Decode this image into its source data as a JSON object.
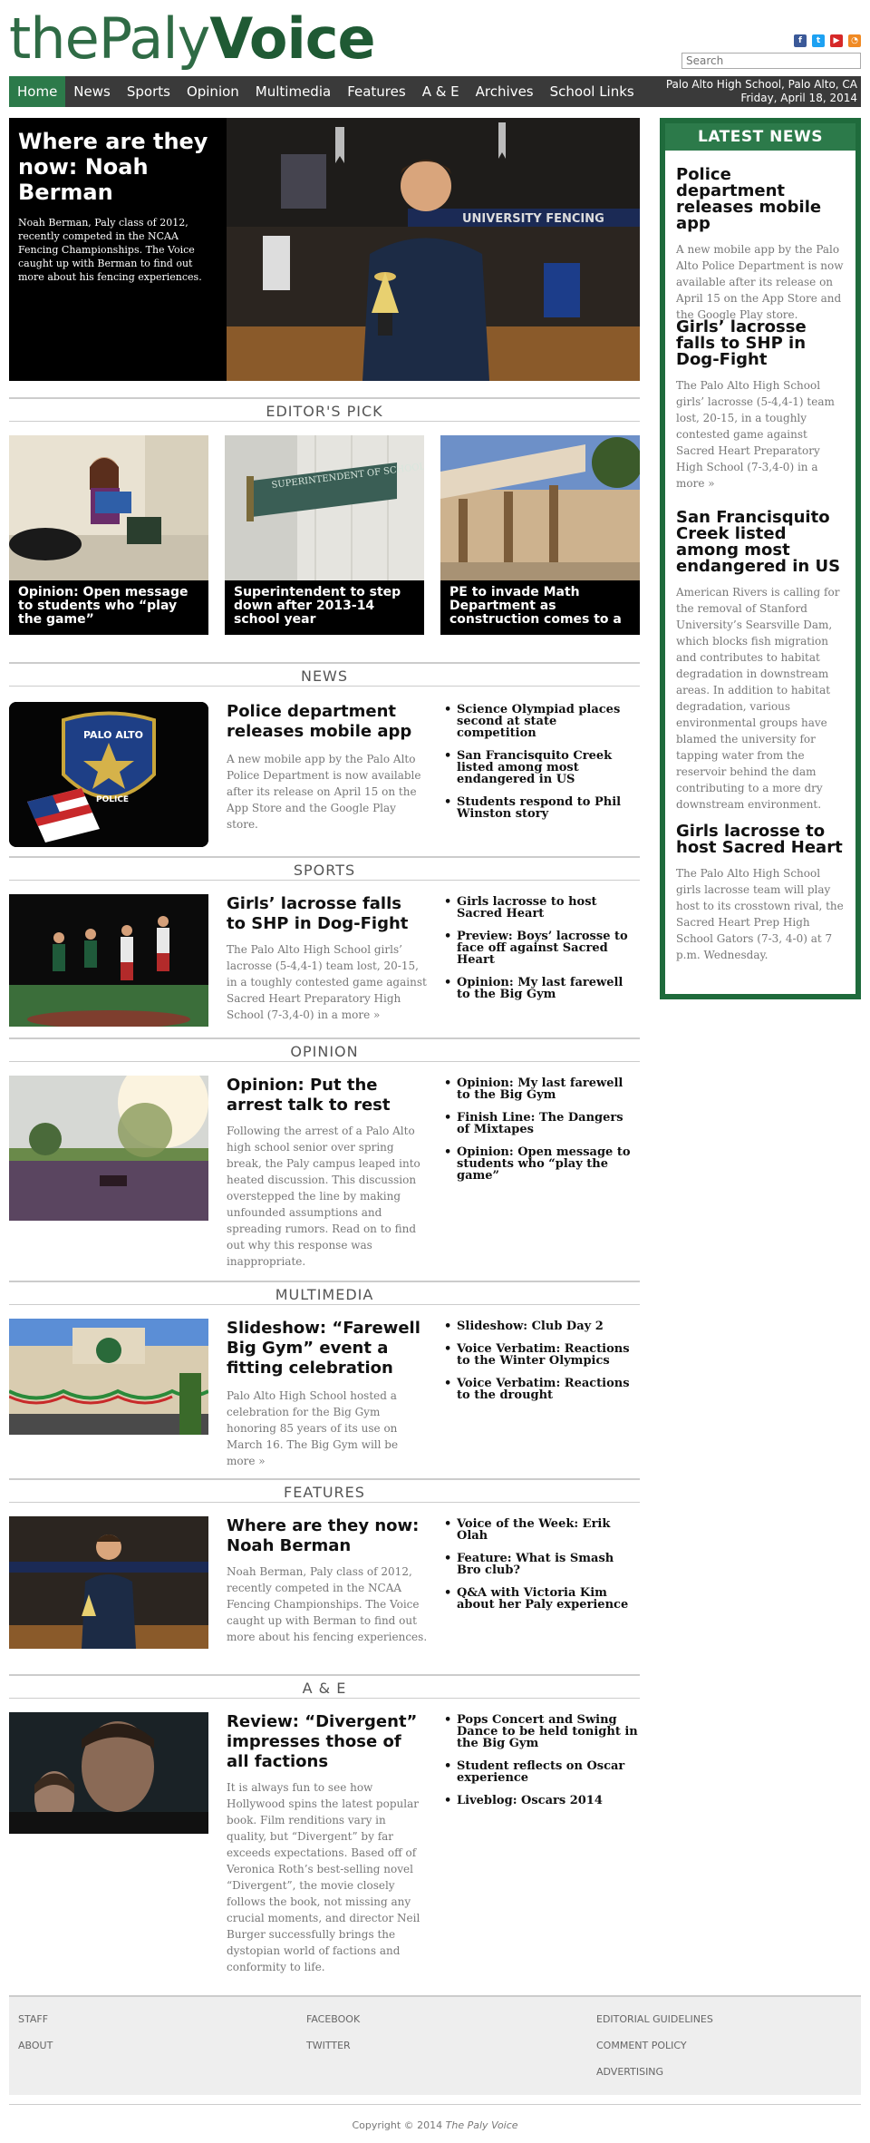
{
  "header": {
    "logo_part1": "the",
    "logo_part2": "Paly",
    "logo_part3": "Voice",
    "search_placeholder": "Search",
    "social": [
      "facebook-icon",
      "twitter-icon",
      "youtube-icon",
      "rss-icon"
    ]
  },
  "nav": {
    "items": [
      "Home",
      "News",
      "Sports",
      "Opinion",
      "Multimedia",
      "Features",
      "A & E",
      "Archives",
      "School Links"
    ],
    "active": "Home",
    "location": "Palo Alto High School, Palo Alto, CA",
    "date": "Friday, April 18, 2014"
  },
  "hero": {
    "title": "Where are they now: Noah Berman",
    "text": "Noah Berman, Paly class of 2012, recently competed in the NCAA Fencing Championships. The Voice caught up with Berman to find out more about his fencing experiences."
  },
  "sidebar": {
    "title": "LATEST NEWS",
    "items": [
      {
        "title": "Police department releases mobile app",
        "text": "A new mobile app by the Palo Alto Police Department is now available after its release on April 15 on the App Store and the Google Play store."
      },
      {
        "title": "Girls’ lacrosse falls to SHP in Dog-Fight",
        "text": "The Palo Alto High School girls’ lacrosse (5-4,4-1) team lost, 20-15, in a toughly contested game against Sacred Heart Preparatory High School (7-3,4-0) in a more »"
      },
      {
        "title": "San Francisquito Creek listed among most endangered in US",
        "text": "American Rivers is calling for the removal of Stanford University’s Searsville Dam, which blocks fish migration and contributes to habitat degradation in downstream areas. In addition to habitat degradation, various environmental groups have blamed the university for tapping water from the reservoir behind the dam contributing to a more dry downstream environment."
      },
      {
        "title": "Girls lacrosse to host Sacred Heart",
        "text": "The Palo Alto High School girls lacrosse team will play host to its crosstown rival, the Sacred Heart Prep High School Gators (7-3, 4-0) at 7 p.m. Wednesday."
      }
    ]
  },
  "editors_pick": {
    "heading": "EDITOR'S PICK",
    "items": [
      {
        "caption": "Opinion: Open message to students who “play the game”"
      },
      {
        "caption": "Superintendent to step down after 2013-14 school year",
        "sign": "SUPERINTENDENT OF SCHOOLS"
      },
      {
        "caption": "PE to invade Math Department as construction comes to a"
      }
    ]
  },
  "news": {
    "heading": "NEWS",
    "title": "Police department releases mobile app",
    "text": "A new mobile app by the Palo Alto Police Department is now available after its release on April 15 on the App Store and the Google Play store.",
    "badge_top": "PALO ALTO",
    "badge_bottom": "POLICE",
    "links": [
      "Science Olympiad places second at state competition",
      "San Francisquito Creek listed among most endangered in US",
      "Students respond to Phil Winston story"
    ]
  },
  "sports": {
    "heading": "SPORTS",
    "title": "Girls’ lacrosse falls to SHP in Dog-Fight",
    "text": "The Palo Alto High School girls’ lacrosse (5-4,4-1) team lost, 20-15, in a toughly contested game against Sacred Heart Preparatory High School (7-3,4-0) in a more »",
    "links": [
      "Girls lacrosse to host Sacred Heart",
      "Preview: Boys’ lacrosse to face off against Sacred Heart",
      "Opinion: My last farewell to the Big Gym"
    ]
  },
  "opinion": {
    "heading": "OPINION",
    "title": "Opinion: Put the arrest talk to rest",
    "text": "Following the arrest of a Palo Alto high school senior over spring break, the Paly campus leaped into heated discussion. This discussion overstepped the line by making unfounded assumptions and spreading rumors. Read on to find out why this response was inappropriate.",
    "links": [
      "Opinion: My last farewell to the Big Gym",
      "Finish Line: The Dangers of Mixtapes",
      "Opinion: Open message to students who “play the game”"
    ]
  },
  "multimedia": {
    "heading": "MULTIMEDIA",
    "title": "Slideshow: “Farewell Big Gym” event a fitting celebration",
    "text": "Palo Alto High School hosted a celebration for the Big Gym honoring 85 years of its use on March 16. The Big Gym will be more »",
    "links": [
      "Slideshow: Club Day 2",
      "Voice Verbatim: Reactions to the Winter Olympics",
      "Voice Verbatim: Reactions to the drought"
    ]
  },
  "features": {
    "heading": "FEATURES",
    "title": "Where are they now: Noah Berman",
    "text": "Noah Berman, Paly class of 2012, recently competed in the NCAA Fencing Championships. The Voice caught up with Berman to find out more about his fencing experiences.",
    "links": [
      "Voice of the Week: Erik Olah",
      "Feature: What is Smash Bro club?",
      "Q&A with Victoria Kim about her Paly experience"
    ]
  },
  "ae": {
    "heading": "A & E",
    "title": "Review: “Divergent” impresses those of all factions",
    "text": "It is always fun to see how Hollywood spins the latest popular book. Film renditions vary in quality, but “Divergent” by far exceeds expectations. Based off of Veronica Roth’s best-selling novel “Divergent”, the movie closely follows the book, not missing any crucial moments, and director Neil Burger successfully brings the dystopian world of factions and conformity to life.",
    "links": [
      "Pops Concert and Swing Dance to be held tonight in the Big Gym",
      "Student reflects on Oscar experience",
      "Liveblog: Oscars 2014"
    ]
  },
  "footer": {
    "col1": [
      "STAFF",
      "ABOUT"
    ],
    "col2": [
      "FACEBOOK",
      "TWITTER"
    ],
    "col3": [
      "EDITORIAL GUIDELINES",
      "COMMENT POLICY",
      "ADVERTISING"
    ],
    "copyright_prefix": "Copyright © 2014 ",
    "copyright_name": "The Paly Voice"
  },
  "colors": {
    "brand_green": "#2c7a4a",
    "nav_bg": "#3a3a3a",
    "sidebar_border": "#1f6b3c"
  }
}
